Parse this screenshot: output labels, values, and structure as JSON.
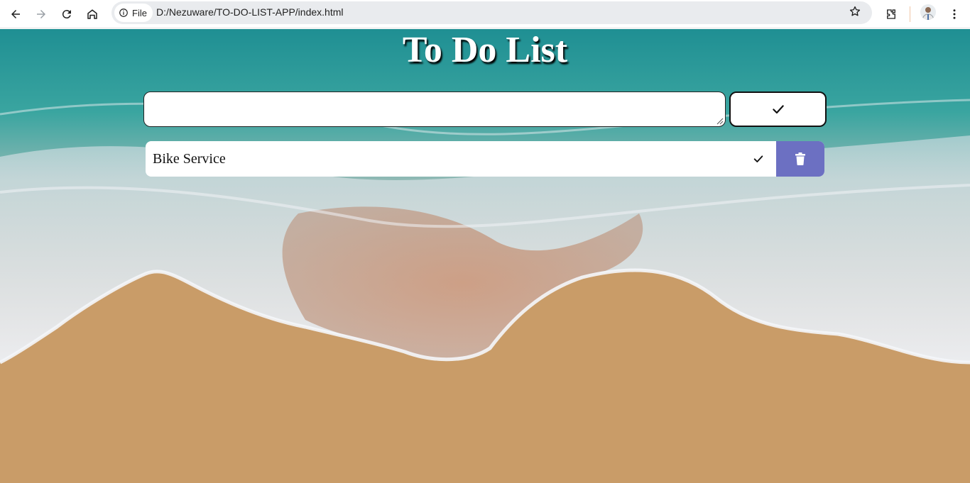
{
  "browser": {
    "file_chip_label": "File",
    "url": "D:/Nezuware/TO-DO-LIST-APP/index.html",
    "icons": [
      "back-icon",
      "forward-icon",
      "reload-icon",
      "home-icon",
      "info-icon",
      "star-icon",
      "extensions-icon",
      "profile-avatar",
      "menu-icon"
    ]
  },
  "app": {
    "title": "To Do List",
    "input_value": "",
    "add_icon": "check-icon",
    "todos": [
      {
        "text": "Bike Service",
        "complete_icon": "check-icon",
        "delete_icon": "trash-icon"
      }
    ]
  },
  "colors": {
    "delete_button": "#6c70c2",
    "title_text": "#ffffff"
  }
}
